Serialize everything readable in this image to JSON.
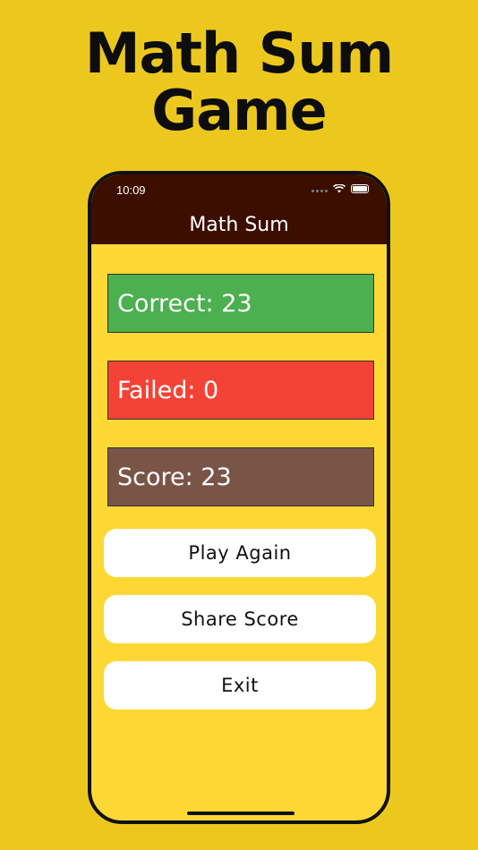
{
  "promo": {
    "title_line1": "Math Sum",
    "title_line2": "Game"
  },
  "status_bar": {
    "time": "10:09"
  },
  "app": {
    "title": "Math Sum"
  },
  "stats": {
    "correct": "Correct: 23",
    "failed": "Failed: 0",
    "score": "Score: 23"
  },
  "buttons": {
    "play_again": "Play Again",
    "share_score": "Share Score",
    "exit": "Exit"
  },
  "colors": {
    "background": "#ECC81F",
    "screen": "#FDD835",
    "nav": "#3B0E00",
    "correct": "#4CAF50",
    "failed": "#F44336",
    "score": "#795548"
  }
}
